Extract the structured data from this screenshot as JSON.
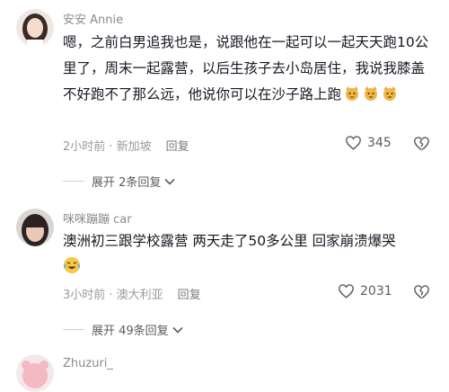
{
  "comments": [
    {
      "username": "安安 Annie",
      "text": "嗯，之前白男追我也是，说跟他在一起可以一起天天跑10公里了，周末一起露营，以后生孩子去小岛居住，我说我膝盖不好跑不了那么远，他说你可以在沙子路上跑",
      "time_location": "2小时前 · 新加坡",
      "reply_label": "回复",
      "likes": "345",
      "expand_label": "展开 2条回复",
      "emoji_icons": [
        "cat-face-icon",
        "cat-face-icon",
        "cat-face-icon"
      ]
    },
    {
      "username": "咪咪蹦蹦 car",
      "text": "澳洲初三跟学校露营 两天走了50多公里 回家崩溃爆哭",
      "time_location": "3小时前 · 澳大利亚",
      "reply_label": "回复",
      "likes": "2031",
      "expand_label": "展开 49条回复",
      "emoji_icons": [
        "crying-laughing-face-icon"
      ]
    },
    {
      "username": "Zhuzuri_"
    }
  ],
  "colors": {
    "text": "#161823",
    "muted": "#8a8b91",
    "icon": "#5b5c62"
  }
}
